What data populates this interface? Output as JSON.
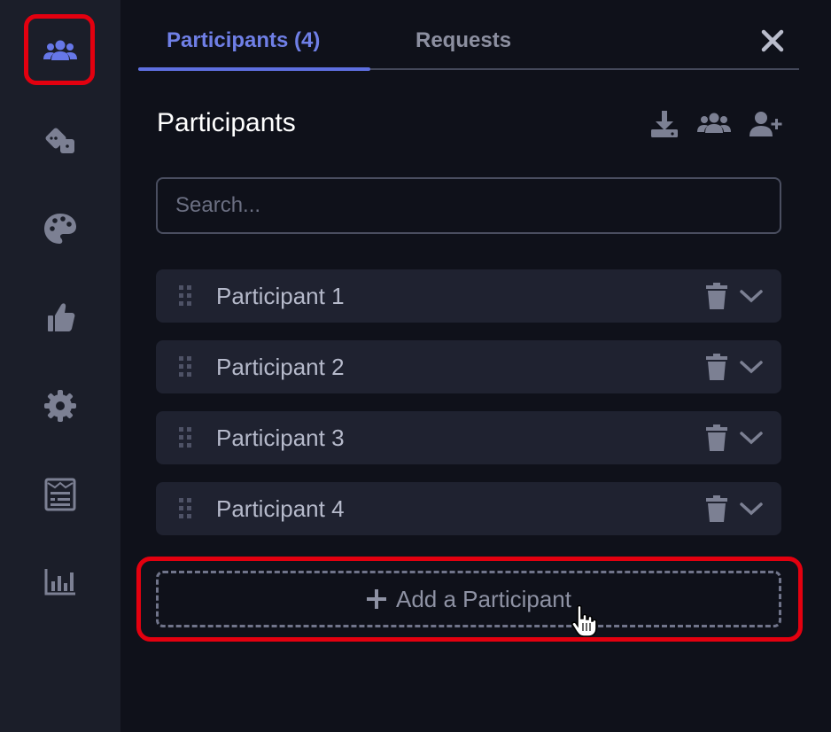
{
  "tabs": [
    {
      "label": "Participants (4)",
      "active": true
    },
    {
      "label": "Requests",
      "active": false
    }
  ],
  "sidebar": {
    "items": [
      {
        "icon": "users-icon",
        "active": true
      },
      {
        "icon": "dice-icon"
      },
      {
        "icon": "palette-icon"
      },
      {
        "icon": "thumbs-up-icon"
      },
      {
        "icon": "gear-icon"
      },
      {
        "icon": "receipt-icon"
      },
      {
        "icon": "bar-chart-icon"
      }
    ]
  },
  "panel": {
    "heading": "Participants",
    "header_icons": [
      "download-icon",
      "users-icon",
      "add-user-icon"
    ],
    "search": {
      "placeholder": "Search...",
      "value": ""
    },
    "participants": [
      {
        "name": "Participant 1"
      },
      {
        "name": "Participant 2"
      },
      {
        "name": "Participant 3"
      },
      {
        "name": "Participant 4"
      }
    ],
    "add_button_label": "Add a Participant"
  },
  "colors": {
    "accent": "#5e6fe0",
    "highlight": "#e3000f",
    "rail_bg": "#1b1e29",
    "panel_bg": "#0f111a",
    "row_bg": "#1f2230"
  }
}
